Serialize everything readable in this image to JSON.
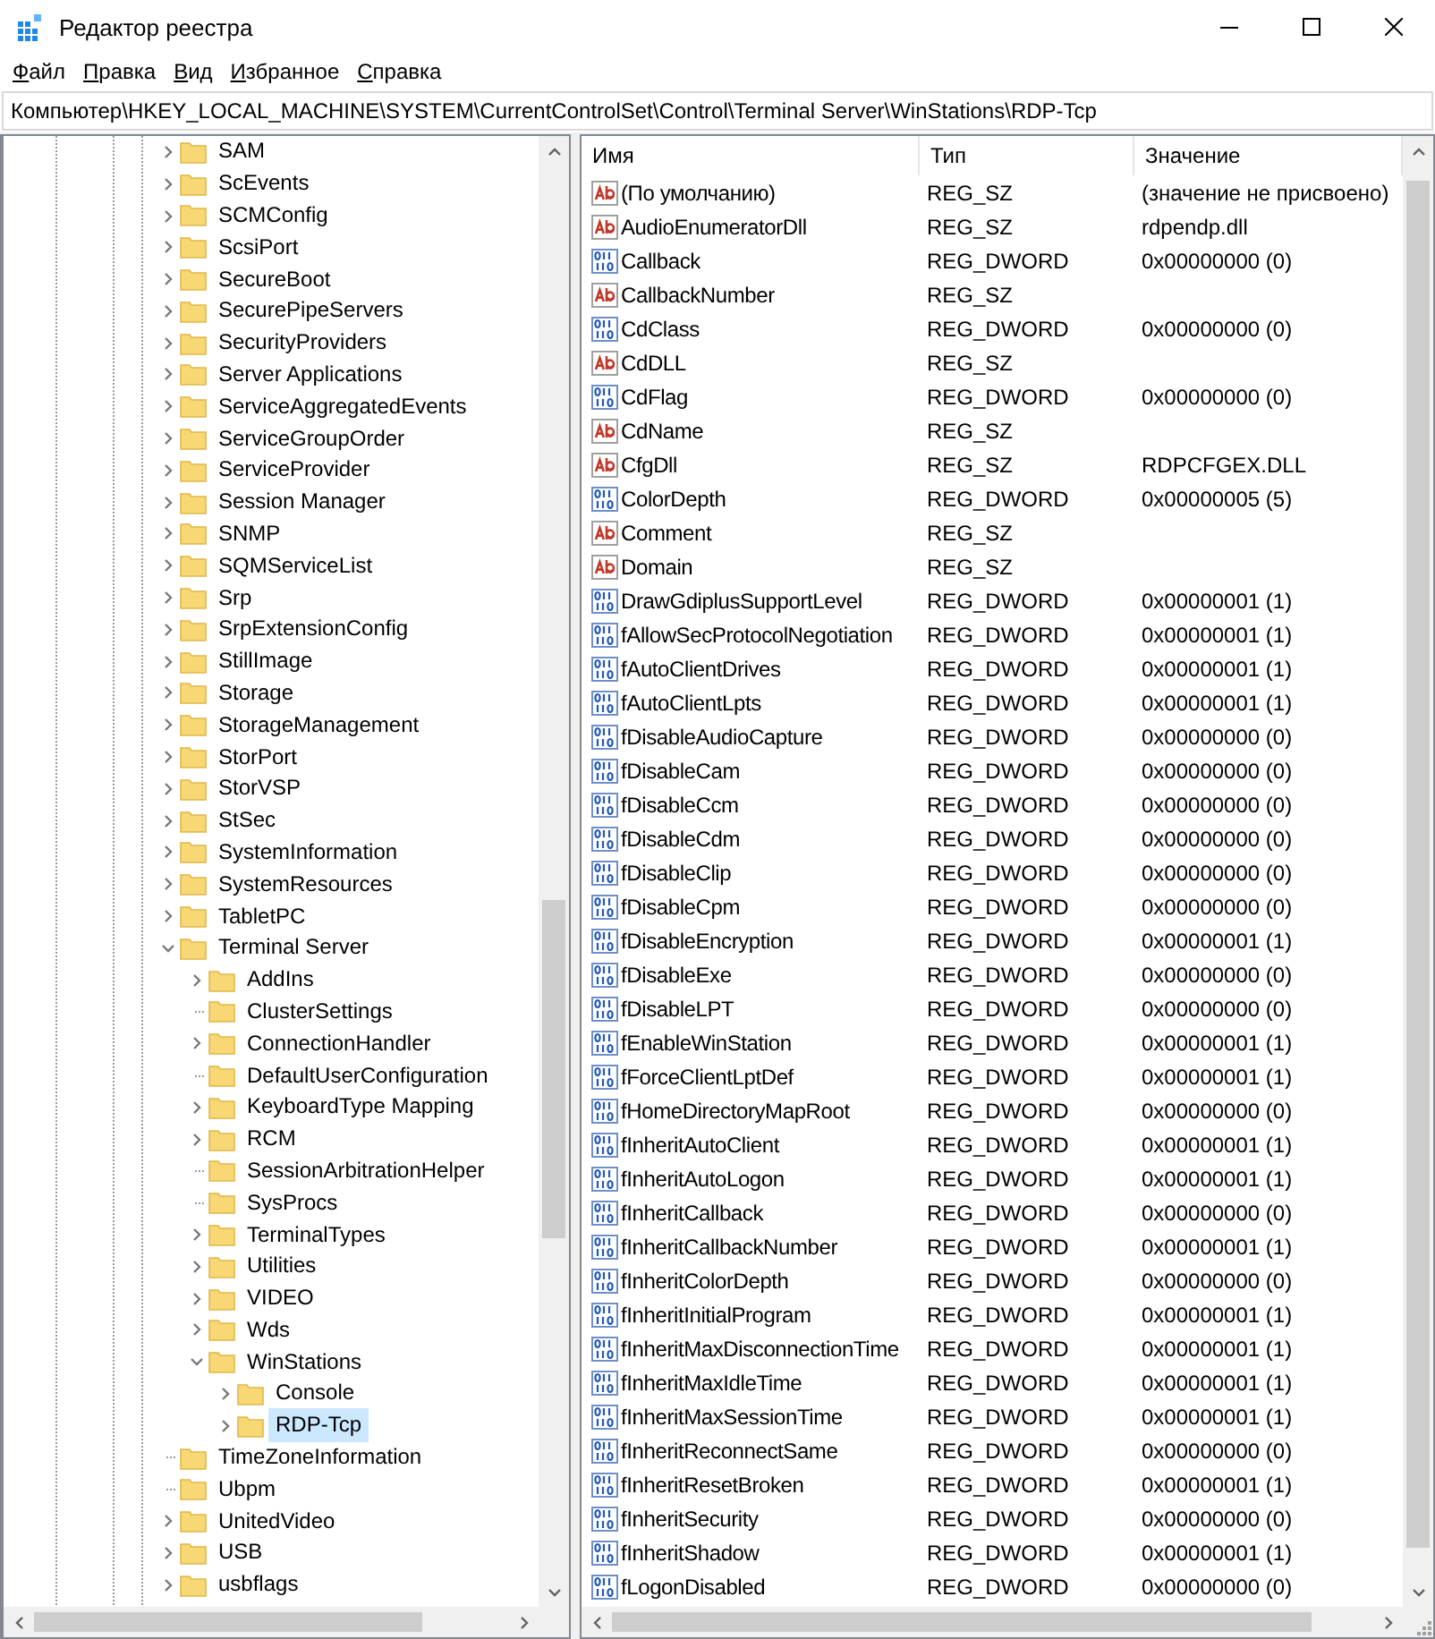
{
  "window": {
    "title": "Редактор реестра"
  },
  "menu": [
    "Файл",
    "Правка",
    "Вид",
    "Избранное",
    "Справка"
  ],
  "address": "Компьютер\\HKEY_LOCAL_MACHINE\\SYSTEM\\CurrentControlSet\\Control\\Terminal Server\\WinStations\\RDP-Tcp",
  "tree": {
    "items": [
      {
        "label": "SAM",
        "expandable": true,
        "expanded": false,
        "selected": false
      },
      {
        "label": "ScEvents",
        "expandable": true,
        "expanded": false,
        "selected": false
      },
      {
        "label": "SCMConfig",
        "expandable": true,
        "expanded": false,
        "selected": false
      },
      {
        "label": "ScsiPort",
        "expandable": true,
        "expanded": false,
        "selected": false
      },
      {
        "label": "SecureBoot",
        "expandable": true,
        "expanded": false,
        "selected": false
      },
      {
        "label": "SecurePipeServers",
        "expandable": true,
        "expanded": false,
        "selected": false
      },
      {
        "label": "SecurityProviders",
        "expandable": true,
        "expanded": false,
        "selected": false
      },
      {
        "label": "Server Applications",
        "expandable": true,
        "expanded": false,
        "selected": false
      },
      {
        "label": "ServiceAggregatedEvents",
        "expandable": true,
        "expanded": false,
        "selected": false
      },
      {
        "label": "ServiceGroupOrder",
        "expandable": true,
        "expanded": false,
        "selected": false
      },
      {
        "label": "ServiceProvider",
        "expandable": true,
        "expanded": false,
        "selected": false
      },
      {
        "label": "Session Manager",
        "expandable": true,
        "expanded": false,
        "selected": false
      },
      {
        "label": "SNMP",
        "expandable": true,
        "expanded": false,
        "selected": false
      },
      {
        "label": "SQMServiceList",
        "expandable": true,
        "expanded": false,
        "selected": false
      },
      {
        "label": "Srp",
        "expandable": true,
        "expanded": false,
        "selected": false
      },
      {
        "label": "SrpExtensionConfig",
        "expandable": true,
        "expanded": false,
        "selected": false
      },
      {
        "label": "StillImage",
        "expandable": true,
        "expanded": false,
        "selected": false
      },
      {
        "label": "Storage",
        "expandable": true,
        "expanded": false,
        "selected": false
      },
      {
        "label": "StorageManagement",
        "expandable": true,
        "expanded": false,
        "selected": false
      },
      {
        "label": "StorPort",
        "expandable": true,
        "expanded": false,
        "selected": false
      },
      {
        "label": "StorVSP",
        "expandable": true,
        "expanded": false,
        "selected": false
      },
      {
        "label": "StSec",
        "expandable": true,
        "expanded": false,
        "selected": false
      },
      {
        "label": "SystemInformation",
        "expandable": true,
        "expanded": false,
        "selected": false
      },
      {
        "label": "SystemResources",
        "expandable": true,
        "expanded": false,
        "selected": false
      },
      {
        "label": "TabletPC",
        "expandable": true,
        "expanded": false,
        "selected": false
      },
      {
        "label": "Terminal Server",
        "expandable": true,
        "expanded": true,
        "selected": false,
        "children": [
          {
            "label": "AddIns",
            "expandable": true,
            "expanded": false,
            "selected": false
          },
          {
            "label": "ClusterSettings",
            "expandable": false,
            "selected": false
          },
          {
            "label": "ConnectionHandler",
            "expandable": true,
            "expanded": false,
            "selected": false
          },
          {
            "label": "DefaultUserConfiguration",
            "expandable": false,
            "selected": false
          },
          {
            "label": "KeyboardType Mapping",
            "expandable": true,
            "expanded": false,
            "selected": false
          },
          {
            "label": "RCM",
            "expandable": true,
            "expanded": false,
            "selected": false
          },
          {
            "label": "SessionArbitrationHelper",
            "expandable": false,
            "selected": false
          },
          {
            "label": "SysProcs",
            "expandable": false,
            "selected": false
          },
          {
            "label": "TerminalTypes",
            "expandable": true,
            "expanded": false,
            "selected": false
          },
          {
            "label": "Utilities",
            "expandable": true,
            "expanded": false,
            "selected": false
          },
          {
            "label": "VIDEO",
            "expandable": true,
            "expanded": false,
            "selected": false
          },
          {
            "label": "Wds",
            "expandable": true,
            "expanded": false,
            "selected": false
          },
          {
            "label": "WinStations",
            "expandable": true,
            "expanded": true,
            "selected": false,
            "children": [
              {
                "label": "Console",
                "expandable": true,
                "expanded": false,
                "selected": false
              },
              {
                "label": "RDP-Tcp",
                "expandable": true,
                "expanded": false,
                "selected": true
              }
            ]
          }
        ]
      },
      {
        "label": "TimeZoneInformation",
        "expandable": false,
        "selected": false
      },
      {
        "label": "Ubpm",
        "expandable": false,
        "selected": false
      },
      {
        "label": "UnitedVideo",
        "expandable": true,
        "expanded": false,
        "selected": false
      },
      {
        "label": "USB",
        "expandable": true,
        "expanded": false,
        "selected": false
      },
      {
        "label": "usbflags",
        "expandable": true,
        "expanded": false,
        "selected": false
      }
    ]
  },
  "values": {
    "columns": [
      "Имя",
      "Тип",
      "Значение"
    ],
    "rows": [
      {
        "kind": "string",
        "name": "(По умолчанию)",
        "type": "REG_SZ",
        "value": "(значение не присвоено)"
      },
      {
        "kind": "string",
        "name": "AudioEnumeratorDll",
        "type": "REG_SZ",
        "value": "rdpendp.dll"
      },
      {
        "kind": "dword",
        "name": "Callback",
        "type": "REG_DWORD",
        "value": "0x00000000 (0)"
      },
      {
        "kind": "string",
        "name": "CallbackNumber",
        "type": "REG_SZ"
      },
      {
        "kind": "dword",
        "name": "CdClass",
        "type": "REG_DWORD",
        "value": "0x00000000 (0)"
      },
      {
        "kind": "string",
        "name": "CdDLL",
        "type": "REG_SZ"
      },
      {
        "kind": "dword",
        "name": "CdFlag",
        "type": "REG_DWORD",
        "value": "0x00000000 (0)"
      },
      {
        "kind": "string",
        "name": "CdName",
        "type": "REG_SZ"
      },
      {
        "kind": "string",
        "name": "CfgDll",
        "type": "REG_SZ",
        "value": "RDPCFGEX.DLL"
      },
      {
        "kind": "dword",
        "name": "ColorDepth",
        "type": "REG_DWORD",
        "value": "0x00000005 (5)"
      },
      {
        "kind": "string",
        "name": "Comment",
        "type": "REG_SZ"
      },
      {
        "kind": "string",
        "name": "Domain",
        "type": "REG_SZ"
      },
      {
        "kind": "dword",
        "name": "DrawGdiplusSupportLevel",
        "type": "REG_DWORD",
        "value": "0x00000001 (1)"
      },
      {
        "kind": "dword",
        "name": "fAllowSecProtocolNegotiation",
        "type": "REG_DWORD",
        "value": "0x00000001 (1)"
      },
      {
        "kind": "dword",
        "name": "fAutoClientDrives",
        "type": "REG_DWORD",
        "value": "0x00000001 (1)"
      },
      {
        "kind": "dword",
        "name": "fAutoClientLpts",
        "type": "REG_DWORD",
        "value": "0x00000001 (1)"
      },
      {
        "kind": "dword",
        "name": "fDisableAudioCapture",
        "type": "REG_DWORD",
        "value": "0x00000000 (0)"
      },
      {
        "kind": "dword",
        "name": "fDisableCam",
        "type": "REG_DWORD",
        "value": "0x00000000 (0)"
      },
      {
        "kind": "dword",
        "name": "fDisableCcm",
        "type": "REG_DWORD",
        "value": "0x00000000 (0)"
      },
      {
        "kind": "dword",
        "name": "fDisableCdm",
        "type": "REG_DWORD",
        "value": "0x00000000 (0)"
      },
      {
        "kind": "dword",
        "name": "fDisableClip",
        "type": "REG_DWORD",
        "value": "0x00000000 (0)"
      },
      {
        "kind": "dword",
        "name": "fDisableCpm",
        "type": "REG_DWORD",
        "value": "0x00000000 (0)"
      },
      {
        "kind": "dword",
        "name": "fDisableEncryption",
        "type": "REG_DWORD",
        "value": "0x00000001 (1)"
      },
      {
        "kind": "dword",
        "name": "fDisableExe",
        "type": "REG_DWORD",
        "value": "0x00000000 (0)"
      },
      {
        "kind": "dword",
        "name": "fDisableLPT",
        "type": "REG_DWORD",
        "value": "0x00000000 (0)"
      },
      {
        "kind": "dword",
        "name": "fEnableWinStation",
        "type": "REG_DWORD",
        "value": "0x00000001 (1)"
      },
      {
        "kind": "dword",
        "name": "fForceClientLptDef",
        "type": "REG_DWORD",
        "value": "0x00000001 (1)"
      },
      {
        "kind": "dword",
        "name": "fHomeDirectoryMapRoot",
        "type": "REG_DWORD",
        "value": "0x00000000 (0)"
      },
      {
        "kind": "dword",
        "name": "fInheritAutoClient",
        "type": "REG_DWORD",
        "value": "0x00000001 (1)"
      },
      {
        "kind": "dword",
        "name": "fInheritAutoLogon",
        "type": "REG_DWORD",
        "value": "0x00000001 (1)"
      },
      {
        "kind": "dword",
        "name": "fInheritCallback",
        "type": "REG_DWORD",
        "value": "0x00000000 (0)"
      },
      {
        "kind": "dword",
        "name": "fInheritCallbackNumber",
        "type": "REG_DWORD",
        "value": "0x00000001 (1)"
      },
      {
        "kind": "dword",
        "name": "fInheritColorDepth",
        "type": "REG_DWORD",
        "value": "0x00000000 (0)"
      },
      {
        "kind": "dword",
        "name": "fInheritInitialProgram",
        "type": "REG_DWORD",
        "value": "0x00000001 (1)"
      },
      {
        "kind": "dword",
        "name": "fInheritMaxDisconnectionTime",
        "type": "REG_DWORD",
        "value": "0x00000001 (1)"
      },
      {
        "kind": "dword",
        "name": "fInheritMaxIdleTime",
        "type": "REG_DWORD",
        "value": "0x00000001 (1)"
      },
      {
        "kind": "dword",
        "name": "fInheritMaxSessionTime",
        "type": "REG_DWORD",
        "value": "0x00000001 (1)"
      },
      {
        "kind": "dword",
        "name": "fInheritReconnectSame",
        "type": "REG_DWORD",
        "value": "0x00000000 (0)"
      },
      {
        "kind": "dword",
        "name": "fInheritResetBroken",
        "type": "REG_DWORD",
        "value": "0x00000001 (1)"
      },
      {
        "kind": "dword",
        "name": "fInheritSecurity",
        "type": "REG_DWORD",
        "value": "0x00000000 (0)"
      },
      {
        "kind": "dword",
        "name": "fInheritShadow",
        "type": "REG_DWORD",
        "value": "0x00000001 (1)"
      },
      {
        "kind": "dword",
        "name": "fLogonDisabled",
        "type": "REG_DWORD",
        "value": "0x00000000 (0)"
      }
    ]
  }
}
